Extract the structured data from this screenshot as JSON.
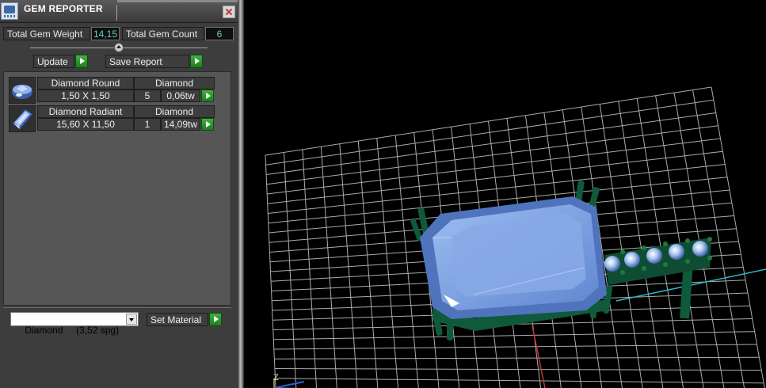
{
  "window": {
    "title": "GEM REPORTER"
  },
  "summary": {
    "total_weight_label": "Total Gem Weight",
    "total_weight_value": "14,15",
    "total_count_label": "Total Gem Count",
    "total_count_value": "6"
  },
  "actions": {
    "update_label": "Update",
    "save_report_label": "Save Report"
  },
  "gems": [
    {
      "name": "Diamond Round",
      "material": "Diamond",
      "size": "1,50 X 1,50",
      "count": "5",
      "weight": "0,06tw",
      "thumb_icon": "round-gem-icon"
    },
    {
      "name": "Diamond Radiant",
      "material": "Diamond",
      "size": "15,60 X 11,50",
      "count": "1",
      "weight": "14,09tw",
      "thumb_icon": "radiant-gem-icon"
    }
  ],
  "material": {
    "selected": "Diamond     (3,52 spg)",
    "set_label": "Set Material"
  },
  "viewport": {
    "axis_label": "Z"
  },
  "colors": {
    "accent_green": "#2a9a2a",
    "value_cyan": "#5fd0d0",
    "gem_blue": "#7ea6e6",
    "prong_green": "#0f5a3a",
    "grid": "#cfcfcf"
  }
}
